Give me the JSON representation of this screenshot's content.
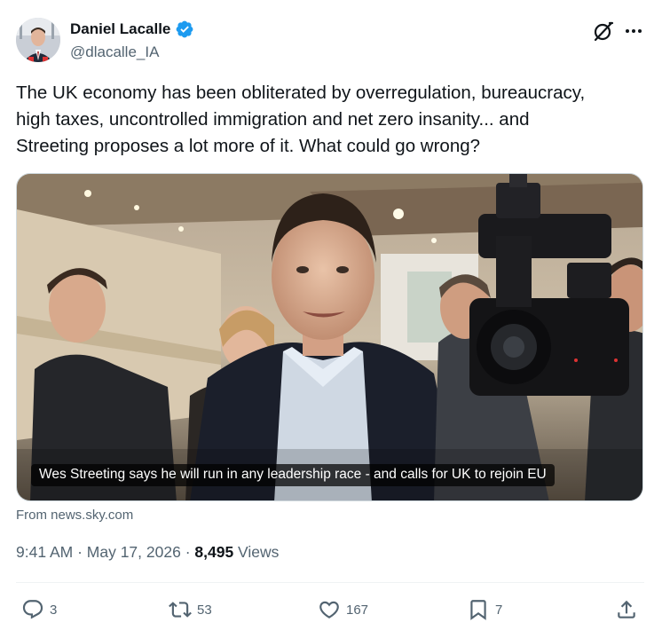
{
  "author": {
    "display_name": "Daniel Lacalle",
    "handle": "@dlacalle_IA",
    "verified": true
  },
  "tweet": {
    "text": "The UK economy has been obliterated by overregulation, bureaucracy,\nhigh taxes, uncontrolled immigration and net zero insanity... and\nStreeting proposes a lot more of it. What could go wrong?"
  },
  "card": {
    "title": "Wes Streeting says he will run in any leadership race - and calls for UK to rejoin EU",
    "source": "From news.sky.com"
  },
  "meta": {
    "time": "9:41 AM",
    "separator": " · ",
    "date": "May 17, 2026",
    "views_count": "8,495",
    "views_label": " Views"
  },
  "actions": {
    "replies": "3",
    "reposts": "53",
    "likes": "167",
    "bookmarks": "7"
  },
  "icons": {
    "verified": "verified-badge-icon",
    "grok": "grok-icon",
    "more": "more-icon",
    "reply": "reply-icon",
    "repost": "repost-icon",
    "like": "like-icon",
    "bookmark": "bookmark-icon",
    "share": "share-icon"
  },
  "colors": {
    "verified": "#1d9bf0",
    "text": "#0f1419",
    "secondary": "#536471",
    "border": "#cfd9de"
  }
}
